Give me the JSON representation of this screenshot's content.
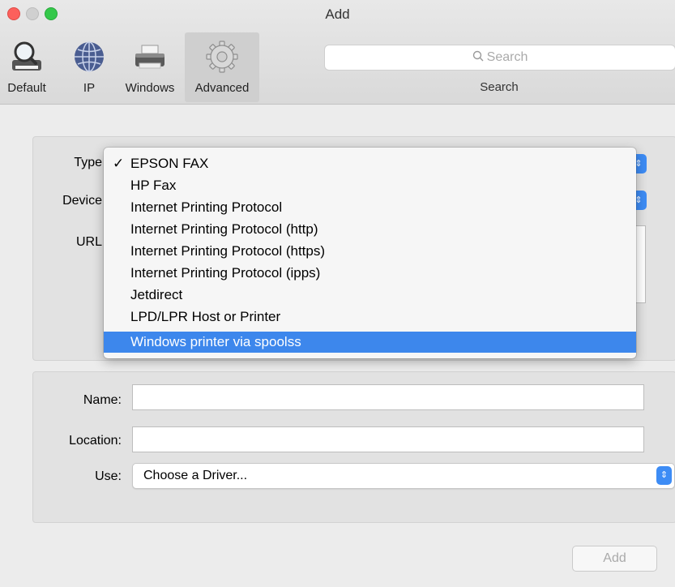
{
  "window": {
    "title": "Add"
  },
  "toolbar": {
    "tabs": [
      {
        "label": "Default",
        "icon": "magnifier-printer-icon"
      },
      {
        "label": "IP",
        "icon": "globe-icon"
      },
      {
        "label": "Windows",
        "icon": "printer-icon"
      },
      {
        "label": "Advanced",
        "icon": "gear-icon",
        "selected": true
      }
    ],
    "search": {
      "placeholder": "Search",
      "label": "Search"
    }
  },
  "form": {
    "type_label": "Type",
    "device_label": "Device",
    "url_label": "URL",
    "name_label": "Name:",
    "name_value": "",
    "location_label": "Location:",
    "location_value": "",
    "use_label": "Use:",
    "use_value": "Choose a Driver..."
  },
  "type_menu": {
    "checkmark": "✓",
    "items": [
      "EPSON FAX",
      "HP Fax",
      "Internet Printing Protocol",
      "Internet Printing Protocol (http)",
      "Internet Printing Protocol (https)",
      "Internet Printing Protocol (ipps)",
      "Jetdirect",
      "LPD/LPR Host or Printer",
      "Windows printer via spoolss"
    ],
    "checked_index": 0,
    "highlighted_index": 8
  },
  "buttons": {
    "add": "Add"
  },
  "colors": {
    "accent": "#3d87ec",
    "close": "#fc605c",
    "zoom": "#34c84a"
  }
}
